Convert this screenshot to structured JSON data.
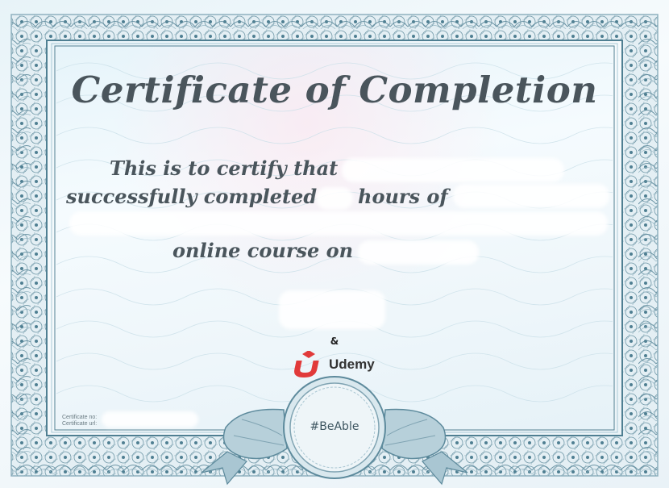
{
  "certificate": {
    "title": "Certificate of Completion",
    "line1": "This is to certify that",
    "line2_prefix": "successfully completed",
    "line2_suffix": "hours of",
    "line3": "online course on",
    "ampersand": "&",
    "brand_name": "Udemy",
    "seal_text": "#BeAble",
    "certificate_no_label": "Certificate no:",
    "certificate_url_label": "Certificate url:"
  },
  "icons": {
    "brand_logo": "udemy-u-icon"
  },
  "colors": {
    "border": "#4f7f92",
    "border_light": "#a9c9d6",
    "text": "#4a555c",
    "brand_red": "#e13a3a",
    "ribbon": "#7fa3b2"
  }
}
